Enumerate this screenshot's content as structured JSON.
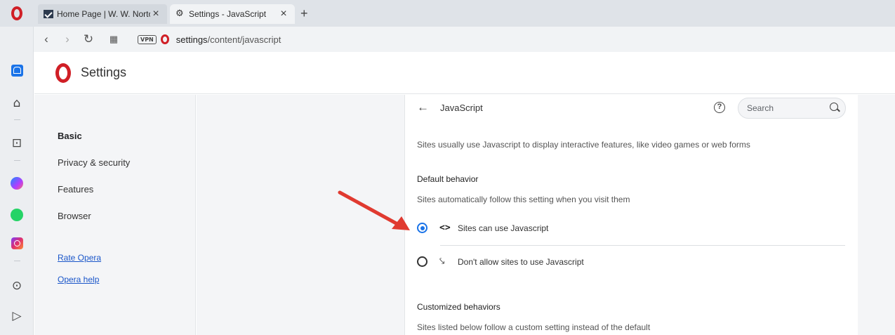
{
  "tabs": [
    {
      "title": "Home Page | W. W. Norton",
      "icon": "norton-favicon"
    },
    {
      "title": "Settings - JavaScript",
      "icon": "gear-icon"
    }
  ],
  "new_tab": "+",
  "address": {
    "vpn": "VPN",
    "url_host": "settings",
    "url_path": "/content/javascript"
  },
  "header": {
    "title": "Settings"
  },
  "nav": {
    "items": [
      "Basic",
      "Privacy & security",
      "Features",
      "Browser"
    ],
    "links": [
      "Rate Opera",
      "Opera help"
    ]
  },
  "page": {
    "title": "JavaScript",
    "search_placeholder": "Search",
    "description": "Sites usually use Javascript to display interactive features, like video games or web forms",
    "default_heading": "Default behavior",
    "default_sub": "Sites automatically follow this setting when you visit them",
    "options": [
      {
        "label": "Sites can use Javascript",
        "selected": true,
        "icon": "code-icon"
      },
      {
        "label": "Don't allow sites to use Javascript",
        "selected": false,
        "icon": "code-off-icon"
      }
    ],
    "custom_heading": "Customized behaviors",
    "custom_sub": "Sites listed below follow a custom setting instead of the default"
  },
  "colors": {
    "accent": "#1a73e8",
    "opera_red": "#d01f26",
    "annotation": "#e03a30"
  }
}
